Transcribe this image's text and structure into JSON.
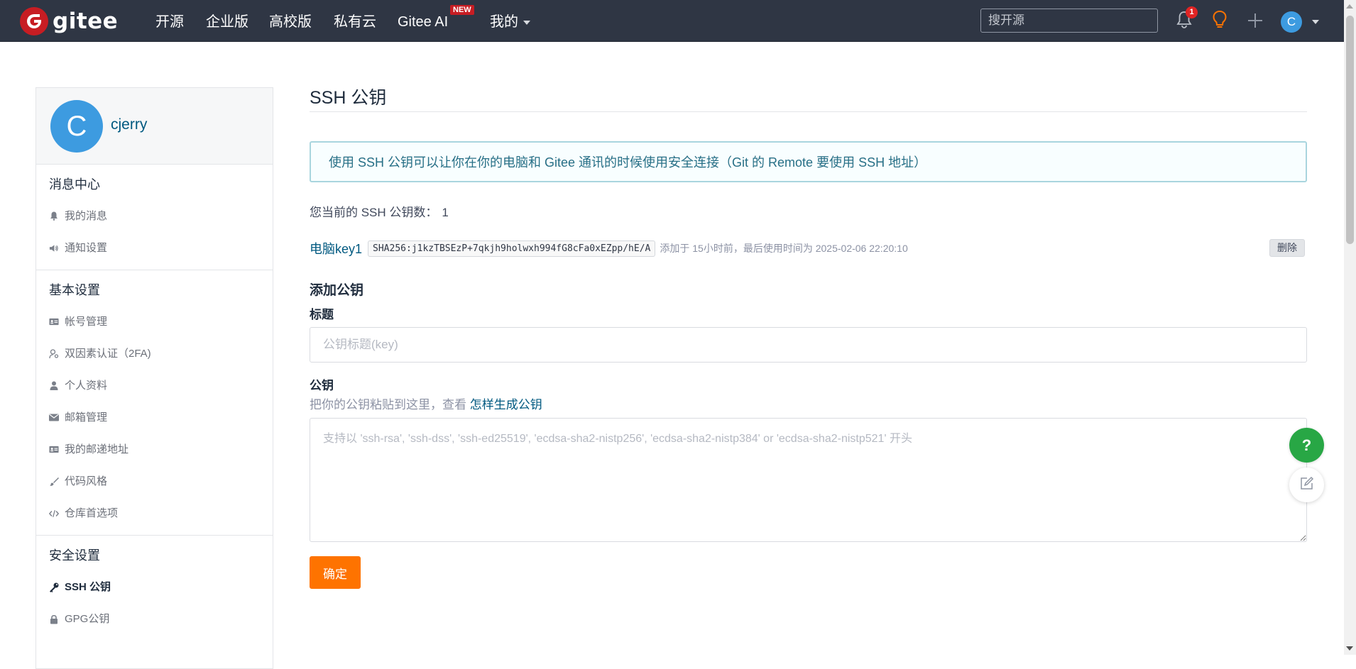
{
  "topbar": {
    "logo_text": "gitee",
    "nav": [
      {
        "label": "开源"
      },
      {
        "label": "企业版"
      },
      {
        "label": "高校版"
      },
      {
        "label": "私有云"
      },
      {
        "label": "Gitee AI"
      },
      {
        "label": "我的"
      }
    ],
    "new_badge": "NEW",
    "search_placeholder": "搜开源",
    "notification_count": "1",
    "avatar_letter": "C",
    "colors": {
      "background": "#2f3644",
      "brand": "#c71d23",
      "lightbulb": "#fe7300"
    },
    "icons": [
      "bell-icon",
      "lightbulb-icon",
      "plus-icon"
    ]
  },
  "sidebar": {
    "avatar_letter": "C",
    "username": "cjerry",
    "groups": [
      {
        "title": "消息中心",
        "items": [
          {
            "label": "我的消息",
            "icon": "bell-icon"
          },
          {
            "label": "通知设置",
            "icon": "megaphone-icon"
          }
        ]
      },
      {
        "title": "基本设置",
        "items": [
          {
            "label": "帐号管理",
            "icon": "id-card-icon"
          },
          {
            "label": "双因素认证（2FA)",
            "icon": "user-key-icon"
          },
          {
            "label": "个人资料",
            "icon": "user-icon"
          },
          {
            "label": "邮箱管理",
            "icon": "envelope-icon"
          },
          {
            "label": "我的邮递地址",
            "icon": "address-card-icon"
          },
          {
            "label": "代码风格",
            "icon": "brush-icon"
          },
          {
            "label": "仓库首选项",
            "icon": "code-icon"
          }
        ]
      },
      {
        "title": "安全设置",
        "items": [
          {
            "label": "SSH 公钥",
            "icon": "key-icon",
            "active": true
          },
          {
            "label": "GPG公钥",
            "icon": "lock-icon"
          }
        ]
      }
    ]
  },
  "main": {
    "title": "SSH 公钥",
    "info": "使用 SSH 公钥可以让你在你的电脑和 Gitee 通讯的时候使用安全连接（Git 的 Remote 要使用 SSH 地址）",
    "count_label": "您当前的 SSH 公钥数：",
    "count_value": "1",
    "keys": [
      {
        "title": "电脑key1",
        "fingerprint": "SHA256:j1kzTBSEzP+7qkjh9holwxh994fG8cFa0xEZpp/hE/A",
        "meta": "添加于 15小时前，最后使用时间为 2025-02-06 22:20:10",
        "delete_label": "删除"
      }
    ],
    "add": {
      "section_title": "添加公钥",
      "title_label": "标题",
      "title_placeholder": "公钥标题(key)",
      "key_label": "公钥",
      "hint": "把你的公钥粘贴到这里，查看 ",
      "hint_link": "怎样生成公钥",
      "key_placeholder": "支持以 'ssh-rsa', 'ssh-dss', 'ssh-ed25519', 'ecdsa-sha2-nistp256', 'ecdsa-sha2-nistp384' or 'ecdsa-sha2-nistp521' 开头",
      "submit_label": "确定"
    }
  },
  "floating": {
    "help_label": "?",
    "colors": {
      "help": "#28a745",
      "submit": "#fe7300"
    }
  }
}
